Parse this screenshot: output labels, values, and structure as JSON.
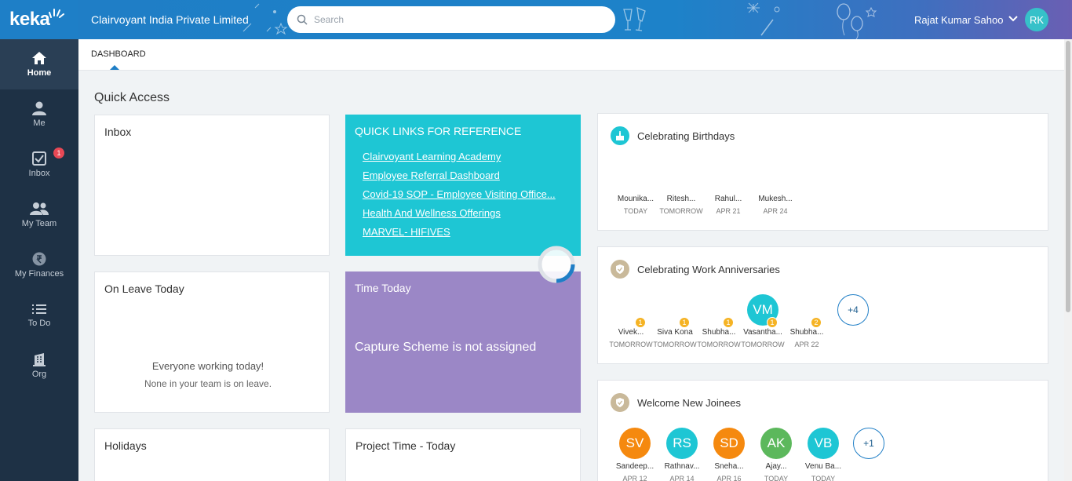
{
  "app": {
    "logo_text": "keka"
  },
  "sidebar": {
    "items": [
      {
        "label": "Home",
        "icon": "home-icon",
        "active": true
      },
      {
        "label": "Me",
        "icon": "person-icon"
      },
      {
        "label": "Inbox",
        "icon": "inbox-check-icon",
        "badge": "1"
      },
      {
        "label": "My Team",
        "icon": "team-icon"
      },
      {
        "label": "My Finances",
        "icon": "rupee-icon"
      },
      {
        "label": "To Do",
        "icon": "list-icon"
      },
      {
        "label": "Org",
        "icon": "building-icon"
      }
    ]
  },
  "header": {
    "company": "Clairvoyant India Private Limited",
    "search_placeholder": "Search",
    "user_name": "Rajat Kumar Sahoo",
    "user_initials": "RK"
  },
  "tabs": {
    "active": "DASHBOARD"
  },
  "quick_access": {
    "title": "Quick Access",
    "inbox_title": "Inbox",
    "links_title": "QUICK LINKS FOR REFERENCE",
    "links": [
      "Clairvoyant Learning Academy",
      "Employee Referral Dashboard",
      "Covid-19 SOP - Employee Visiting Office...",
      "Health And Wellness Offerings",
      "MARVEL- HIFIVES"
    ],
    "on_leave_title": "On Leave Today",
    "on_leave_msg": "Everyone working today!",
    "on_leave_sub": "None in your team is on leave.",
    "time_title": "Time Today",
    "time_msg": "Capture Scheme is not assigned",
    "holidays_title": "Holidays",
    "project_time_title": "Project Time - Today"
  },
  "birthdays": {
    "title": "Celebrating Birthdays",
    "people": [
      {
        "name": "Mounika...",
        "date": "TODAY"
      },
      {
        "name": "Ritesh...",
        "date": "TOMORROW"
      },
      {
        "name": "Rahul...",
        "date": "APR 21"
      },
      {
        "name": "Mukesh...",
        "date": "APR 24"
      }
    ]
  },
  "anniversaries": {
    "title": "Celebrating Work Anniversaries",
    "people": [
      {
        "name": "Vivek...",
        "date": "TOMORROW",
        "years": "1"
      },
      {
        "name": "Siva Kona",
        "date": "TOMORROW",
        "years": "1"
      },
      {
        "name": "Shubha...",
        "date": "TOMORROW",
        "years": "1"
      },
      {
        "name": "Vasantha...",
        "date": "TOMORROW",
        "years": "1",
        "initials": "VM",
        "color": "#1ec6d4"
      },
      {
        "name": "Shubha...",
        "date": "APR 22",
        "years": "2"
      }
    ],
    "more": "+4"
  },
  "joinees": {
    "title": "Welcome New Joinees",
    "people": [
      {
        "initials": "SV",
        "name": "Sandeep...",
        "date": "APR 12",
        "color": "#f5890f"
      },
      {
        "initials": "RS",
        "name": "Rathnav...",
        "date": "APR 14",
        "color": "#1ec6d4"
      },
      {
        "initials": "SD",
        "name": "Sneha...",
        "date": "APR 16",
        "color": "#f5890f"
      },
      {
        "initials": "AK",
        "name": "Ajay...",
        "date": "TODAY",
        "color": "#5cb85c"
      },
      {
        "initials": "VB",
        "name": "Venu Ba...",
        "date": "TODAY",
        "color": "#1ec6d4"
      }
    ],
    "more": "+1"
  }
}
